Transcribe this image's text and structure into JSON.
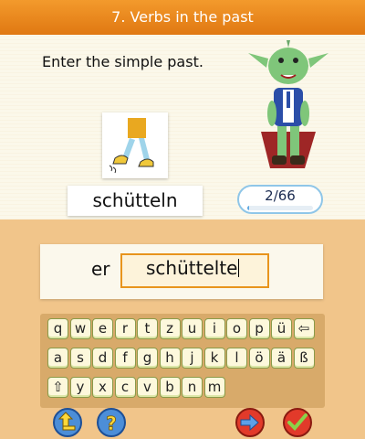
{
  "header": {
    "title": "7. Verbs in the past"
  },
  "task": {
    "instruction": "Enter the simple past."
  },
  "exercise": {
    "word": "schütteln",
    "pronoun": "er",
    "answer": "schüttelte"
  },
  "progress": {
    "label": "2/66",
    "current": 2,
    "total": 66
  },
  "keyboard": {
    "rows": [
      [
        "q",
        "w",
        "e",
        "r",
        "t",
        "z",
        "u",
        "i",
        "o",
        "p",
        "ü",
        "⇦"
      ],
      [
        "a",
        "s",
        "d",
        "f",
        "g",
        "h",
        "j",
        "k",
        "l",
        "ö",
        "ä",
        "ß"
      ],
      [
        "⇧",
        "y",
        "x",
        "c",
        "v",
        "b",
        "n",
        "m"
      ]
    ]
  },
  "bottom_bar": {
    "icons": [
      "back-arrow-icon",
      "help-icon",
      "next-arrow-icon",
      "check-icon"
    ]
  },
  "colors": {
    "accent": "#e8891e",
    "panel": "#fbf8ea",
    "lower": "#f1c58a",
    "progress": "#5fa8e0"
  }
}
